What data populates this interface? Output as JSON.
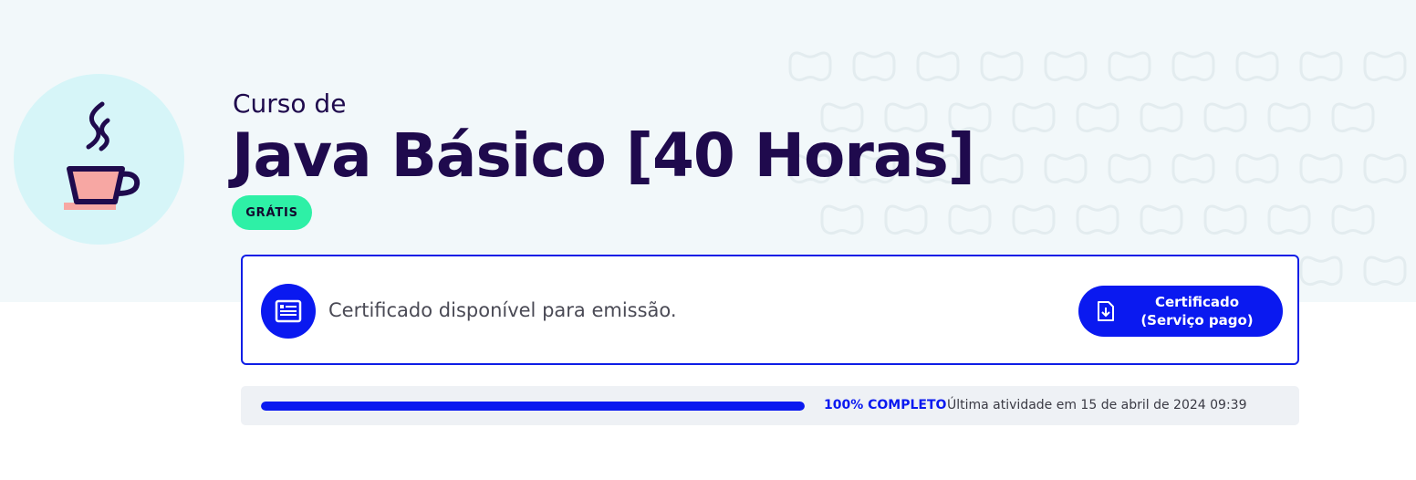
{
  "course": {
    "prefix": "Curso de",
    "title": "Java Básico [40 Horas]",
    "badge": "GRÁTIS",
    "icon": "coffee-cup-icon"
  },
  "certificate": {
    "message": "Certificado disponível para emissão.",
    "button_label": "Certificado (Serviço pago)",
    "card_icon": "certificate-icon",
    "button_icon": "download-document-icon"
  },
  "progress": {
    "percent": 100,
    "status_label": "100% COMPLETO",
    "last_activity": "Última atividade em 15 de abril de 2024 09:39"
  },
  "colors": {
    "primary": "#0a19f0",
    "title": "#1f0a4d",
    "badge": "#2ef0a6",
    "hero_background": "#f2f8fa",
    "icon_circle": "#d6f5f8",
    "cup_accent": "#f7a7a3"
  }
}
